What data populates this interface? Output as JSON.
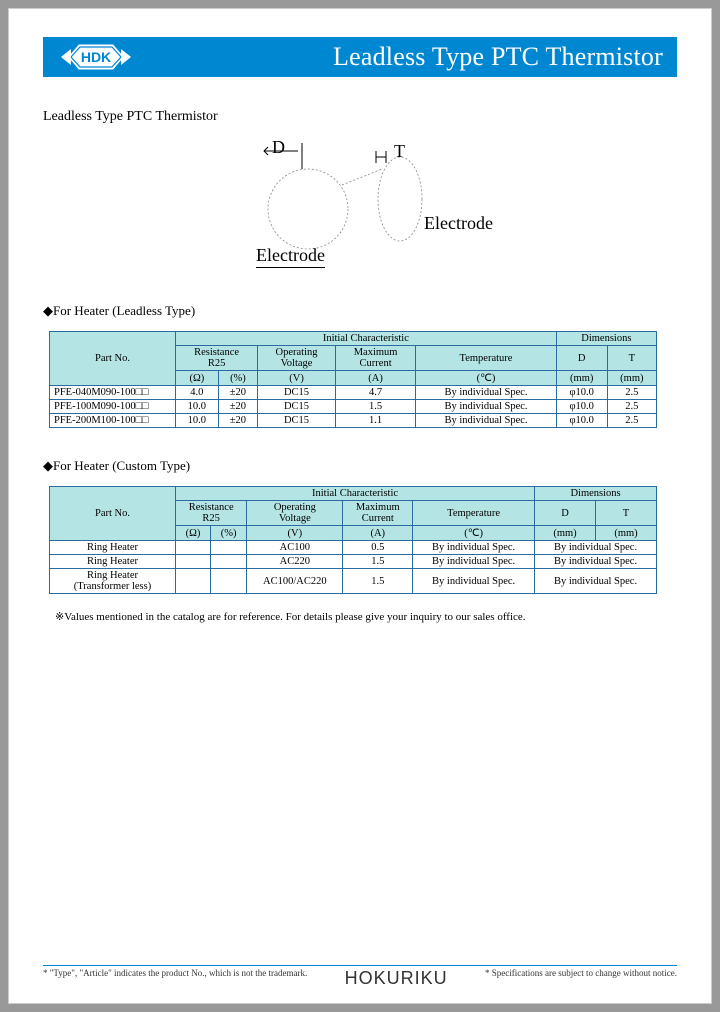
{
  "logo_text": "HDK",
  "title": "Leadless Type PTC Thermistor",
  "heading": "Leadless Type PTC Thermistor",
  "diagram": {
    "D": "D",
    "T": "T",
    "electrode_left": "Electrode",
    "electrode_right": "Electrode"
  },
  "section1_heading": "◆For Heater (Leadless Type)",
  "table1": {
    "head_part": "Part No.",
    "head_initial": "Initial Characteristic",
    "head_dim": "Dimensions",
    "head_res": "Resistance\nR25",
    "head_ov": "Operating\nVoltage",
    "head_mc": "Maximum\nCurrent",
    "head_temp": "Temperature",
    "head_D": "D",
    "head_T": "T",
    "unit_ohm": "(Ω)",
    "unit_pct": "(%)",
    "unit_v": "(V)",
    "unit_a": "(A)",
    "unit_c": "(℃)",
    "unit_mm1": "(mm)",
    "unit_mm2": "(mm)",
    "rows": [
      {
        "part": "PFE-040M090-100□□",
        "ohm": "4.0",
        "pct": "±20",
        "v": "DC15",
        "a": "4.7",
        "temp": "By individual Spec.",
        "d": "φ10.0",
        "t": "2.5"
      },
      {
        "part": "PFE-100M090-100□□",
        "ohm": "10.0",
        "pct": "±20",
        "v": "DC15",
        "a": "1.5",
        "temp": "By individual Spec.",
        "d": "φ10.0",
        "t": "2.5"
      },
      {
        "part": "PFE-200M100-100□□",
        "ohm": "10.0",
        "pct": "±20",
        "v": "DC15",
        "a": "1.1",
        "temp": "By individual Spec.",
        "d": "φ10.0",
        "t": "2.5"
      }
    ]
  },
  "section2_heading": "◆For Heater (Custom Type)",
  "table2": {
    "rows": [
      {
        "part": "Ring Heater",
        "ohm": "",
        "pct": "",
        "v": "AC100",
        "a": "0.5",
        "temp": "By individual Spec.",
        "dim": "By individual Spec."
      },
      {
        "part": "Ring Heater",
        "ohm": "",
        "pct": "",
        "v": "AC220",
        "a": "1.5",
        "temp": "By individual Spec.",
        "dim": "By individual Spec."
      },
      {
        "part": "Ring Heater\n(Transformer less)",
        "ohm": "",
        "pct": "",
        "v": "AC100/AC220",
        "a": "1.5",
        "temp": "By individual Spec.",
        "dim": "By individual Spec."
      }
    ]
  },
  "note": "※Values mentioned in the catalog are for reference. For details please give your inquiry to our sales office.",
  "footer_left": "* \"Type\", \"Article\" indicates the product No., which is not the trademark.",
  "footer_brand": "HOKURIKU",
  "footer_right": "* Specifications are subject to change without notice."
}
